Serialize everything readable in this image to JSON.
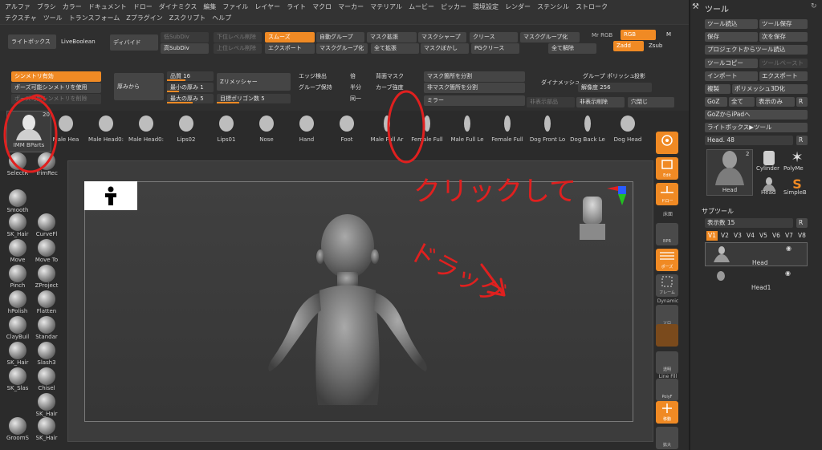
{
  "menu": {
    "row1": [
      "アルファ",
      "ブラシ",
      "カラー",
      "ドキュメント",
      "ドロー",
      "ダイナミクス",
      "編集",
      "ファイル",
      "レイヤー",
      "ライト",
      "マクロ",
      "マーカー",
      "マテリアル",
      "ムービー",
      "ピッカー",
      "環境設定",
      "レンダー",
      "ステンシル",
      "ストローク"
    ],
    "row2": [
      "テクスチャ",
      "ツール",
      "トランスフォーム",
      "Zプラグイン",
      "Zスクリプト",
      "ヘルプ"
    ]
  },
  "shelf": {
    "lightbox": "ライトボックス",
    "liveboolean": "LiveBoolean",
    "divide": "ディバイド",
    "low_subdiv": "低SubDiv",
    "high_subdiv": "高SubDiv",
    "del_lower": "下位レベル削除",
    "del_higher": "上位レベル削除",
    "smooth": "スムーズ",
    "export": "エクスポート",
    "auto_group": "自動グループ",
    "mask_group": "マスクグループ化",
    "mask_grow": "マスク拡張",
    "grow_all": "全て拡張",
    "mask_sharpen": "マスクシャープ",
    "mask_blur": "マスクぼかし",
    "crease": "クリース",
    "pg_crease": "PGクリース",
    "mask_group2": "マスクグループ化",
    "uncrease_all": "全て解除",
    "mrgb": "Mr RGB",
    "rgb": "RGB",
    "m": "M",
    "zadd": "Zadd",
    "zsub": "Zsub",
    "symmetry_on": "シンメトリ有効",
    "pose_symmetry": "ポーズ可能シンメトリを使用",
    "del_symmetry": "ポーズ可能シンメトリを削除",
    "thickness": "厚みから",
    "quality": "品質 16",
    "min_thickness": "最小の厚み 1",
    "max_thickness": "最大の厚み 5",
    "zremesher": "Zリメッシャー",
    "target_poly": "目標ポリゴン数 5",
    "edge_detect": "エッジ検出",
    "group_keep": "グループ保持",
    "double": "倍",
    "half": "半分",
    "same": "同一",
    "backface_mask": "背面マスク",
    "curve_strength": "カーブ強度",
    "split_mask": "マスク箇所を分割",
    "split_unmask": "非マスク箇所を分割",
    "mirror": "ミラー",
    "dynamesh": "ダイナメッシュ",
    "groups": "グループ",
    "polish": "ポリッシュ",
    "project": "投影",
    "resolution": "解像度 256",
    "hide_unmasked": "非表示部品",
    "del_hidden": "非表示削除",
    "close_holes": "穴閉じ"
  },
  "brushes": [
    {
      "label": "IMM BParts",
      "badge": "20"
    },
    {
      "label": "Male Hea"
    },
    {
      "label": "Male Head0:"
    },
    {
      "label": "Male Head0:"
    },
    {
      "label": "Lips02"
    },
    {
      "label": "Lips01"
    },
    {
      "label": "Nose"
    },
    {
      "label": "Hand"
    },
    {
      "label": "Foot"
    },
    {
      "label": "Male Full Ar"
    },
    {
      "label": "Female Full"
    },
    {
      "label": "Male Full Le"
    },
    {
      "label": "Female Full"
    },
    {
      "label": "Dog Front Lo"
    },
    {
      "label": "Dog Back Le"
    },
    {
      "label": "Dog Head"
    }
  ],
  "left_tools": [
    {
      "label": "SelectR"
    },
    {
      "label": "TrimRec"
    },
    {
      "label": "Smooth"
    },
    {
      "label": "SK_Hair"
    },
    {
      "label": "CurveFl"
    },
    {
      "label": "Move"
    },
    {
      "label": "Move To"
    },
    {
      "label": "Pinch"
    },
    {
      "label": "ZProject"
    },
    {
      "label": "hPolish"
    },
    {
      "label": "Flatten"
    },
    {
      "label": "ClayBuil"
    },
    {
      "label": "Standar"
    },
    {
      "label": "SK_Hair"
    },
    {
      "label": "Slash3"
    },
    {
      "label": "SK_Slas"
    },
    {
      "label": "Chisel"
    },
    {
      "label": "SK_Hair"
    },
    {
      "label": "GroomS"
    },
    {
      "label": "SK_Hair"
    }
  ],
  "right_strip": {
    "edit": "Edit",
    "draw": "ドロー",
    "floor": "床面",
    "bpr": "BPR",
    "pose": "ポーズ",
    "frame": "フレーム",
    "dynamic": "Dynamic",
    "persp": "ソロ",
    "transp": "透明",
    "linefill": "Line Fill",
    "polyf": "PolyF",
    "move": "移動",
    "scale": "拡大"
  },
  "tool_panel": {
    "title": "ツール",
    "load_tool": "ツール読込",
    "save_tool": "ツール保存",
    "save": "保存",
    "save_as": "次を保存",
    "load_from_project": "プロジェクトからツール読込",
    "copy_tool": "ツールコピー",
    "paste_tool": "ツールペースト",
    "import": "インポート",
    "export": "エクスポート",
    "clone": "複製",
    "to_polymesh": "ポリメッシュ3D化",
    "goz": "GoZ",
    "all": "全て",
    "visible": "表示のみ",
    "r": "R",
    "goz_ipad": "GoZからiPadへ",
    "lightbox_tool": "ライトボックス▶ツール",
    "head_slider": "Head. 48",
    "thumbs": [
      {
        "label": "Head",
        "badge": "2"
      },
      {
        "label": "Cylinder"
      },
      {
        "label": "PolyMe"
      },
      {
        "label": "Head"
      },
      {
        "label": "SimpleB"
      }
    ],
    "subtool_title": "サブツール",
    "display_count": "表示数 15",
    "versions": [
      "V1",
      "V2",
      "V3",
      "V4",
      "V5",
      "V6",
      "V7",
      "V8"
    ],
    "subtools": [
      {
        "label": "Head"
      },
      {
        "label": "Head1"
      }
    ]
  },
  "annotation": {
    "click": "クリックして",
    "drag": "ドラッグ",
    "color": "#e0201f"
  },
  "colors": {
    "accent": "#f08a24",
    "panel": "#2c2c2c",
    "annotation": "#e0201f"
  }
}
